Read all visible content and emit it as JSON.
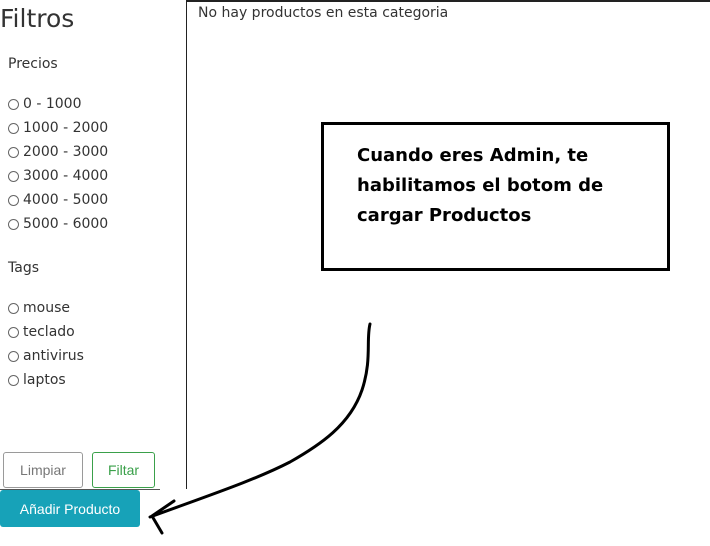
{
  "sidebar": {
    "title": "Filtros",
    "prices_label": "Precios",
    "prices": [
      "0 - 1000",
      "1000 - 2000",
      "2000 - 3000",
      "3000 - 4000",
      "4000 - 5000",
      "5000 - 6000"
    ],
    "tags_label": "Tags",
    "tags": [
      "mouse",
      "teclado",
      "antivirus",
      "laptos"
    ],
    "clear_label": "Limpiar",
    "filter_label": "Filtar",
    "add_product_label": "Añadir Producto"
  },
  "main": {
    "empty_message": "No hay productos en esta categoria"
  },
  "annotation": {
    "lines": [
      "Cuando eres Admin, te",
      "habilitamos el botom de",
      "cargar Productos"
    ]
  },
  "colors": {
    "add_button": "#17a2b8",
    "filter_button": "#3aa04a"
  }
}
